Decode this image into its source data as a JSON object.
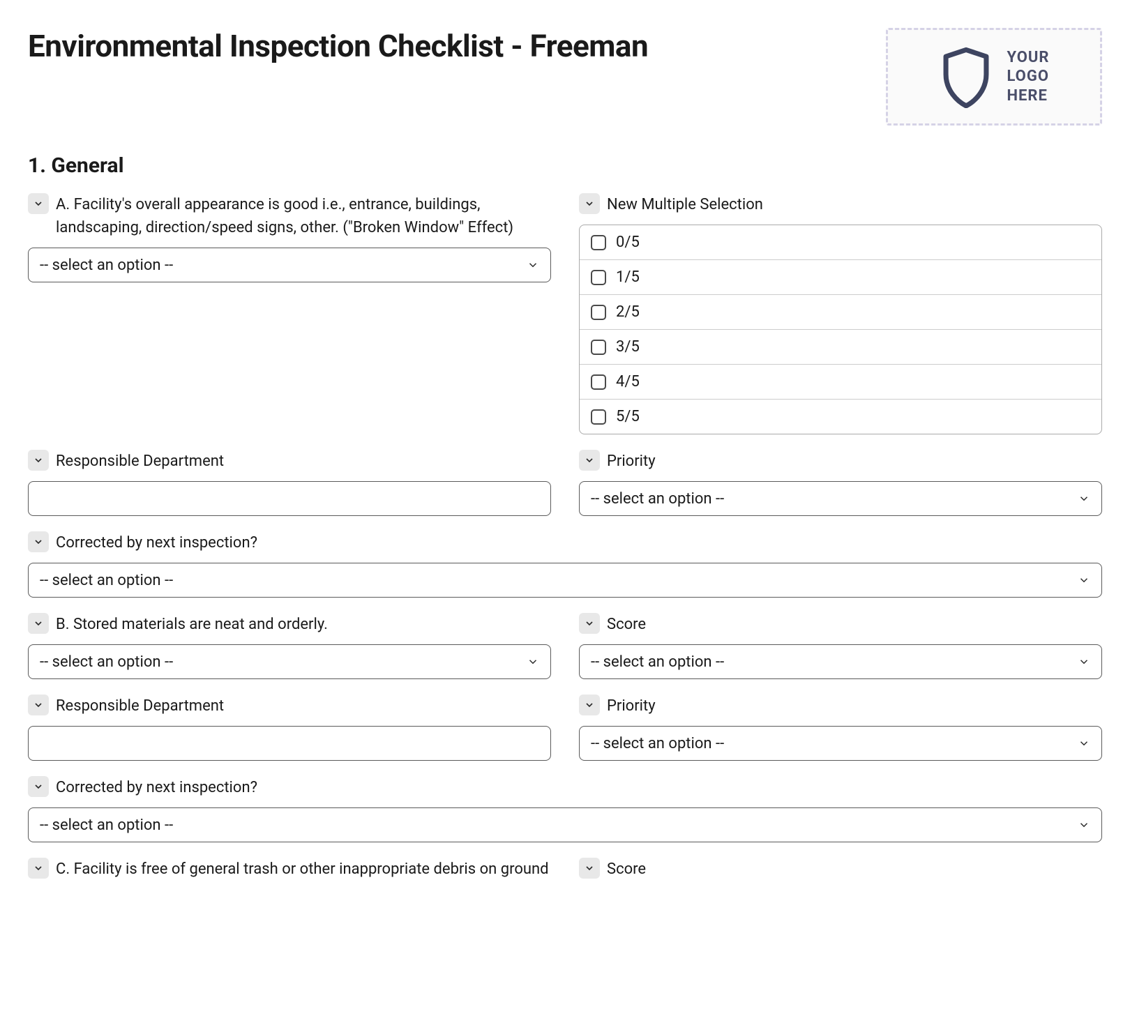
{
  "pageTitle": "Environmental Inspection Checklist - Freeman",
  "logoText": "YOUR\nLOGO\nHERE",
  "sectionTitle": "1. General",
  "selectPlaceholder": "-- select an option --",
  "fields": {
    "a_label": "A. Facility's overall appearance is good i.e., entrance, buildings, landscaping, direction/speed signs, other. (\"Broken Window\" Effect)",
    "multi_label": "New Multiple Selection",
    "multi_options": [
      "0/5",
      "1/5",
      "2/5",
      "3/5",
      "4/5",
      "5/5"
    ],
    "resp_dept_label": "Responsible Department",
    "priority_label": "Priority",
    "corrected_label": "Corrected by next inspection?",
    "b_label": "B. Stored materials are neat and orderly.",
    "score_label": "Score",
    "c_label": "C. Facility is free of general trash or other inappropriate debris on ground"
  }
}
